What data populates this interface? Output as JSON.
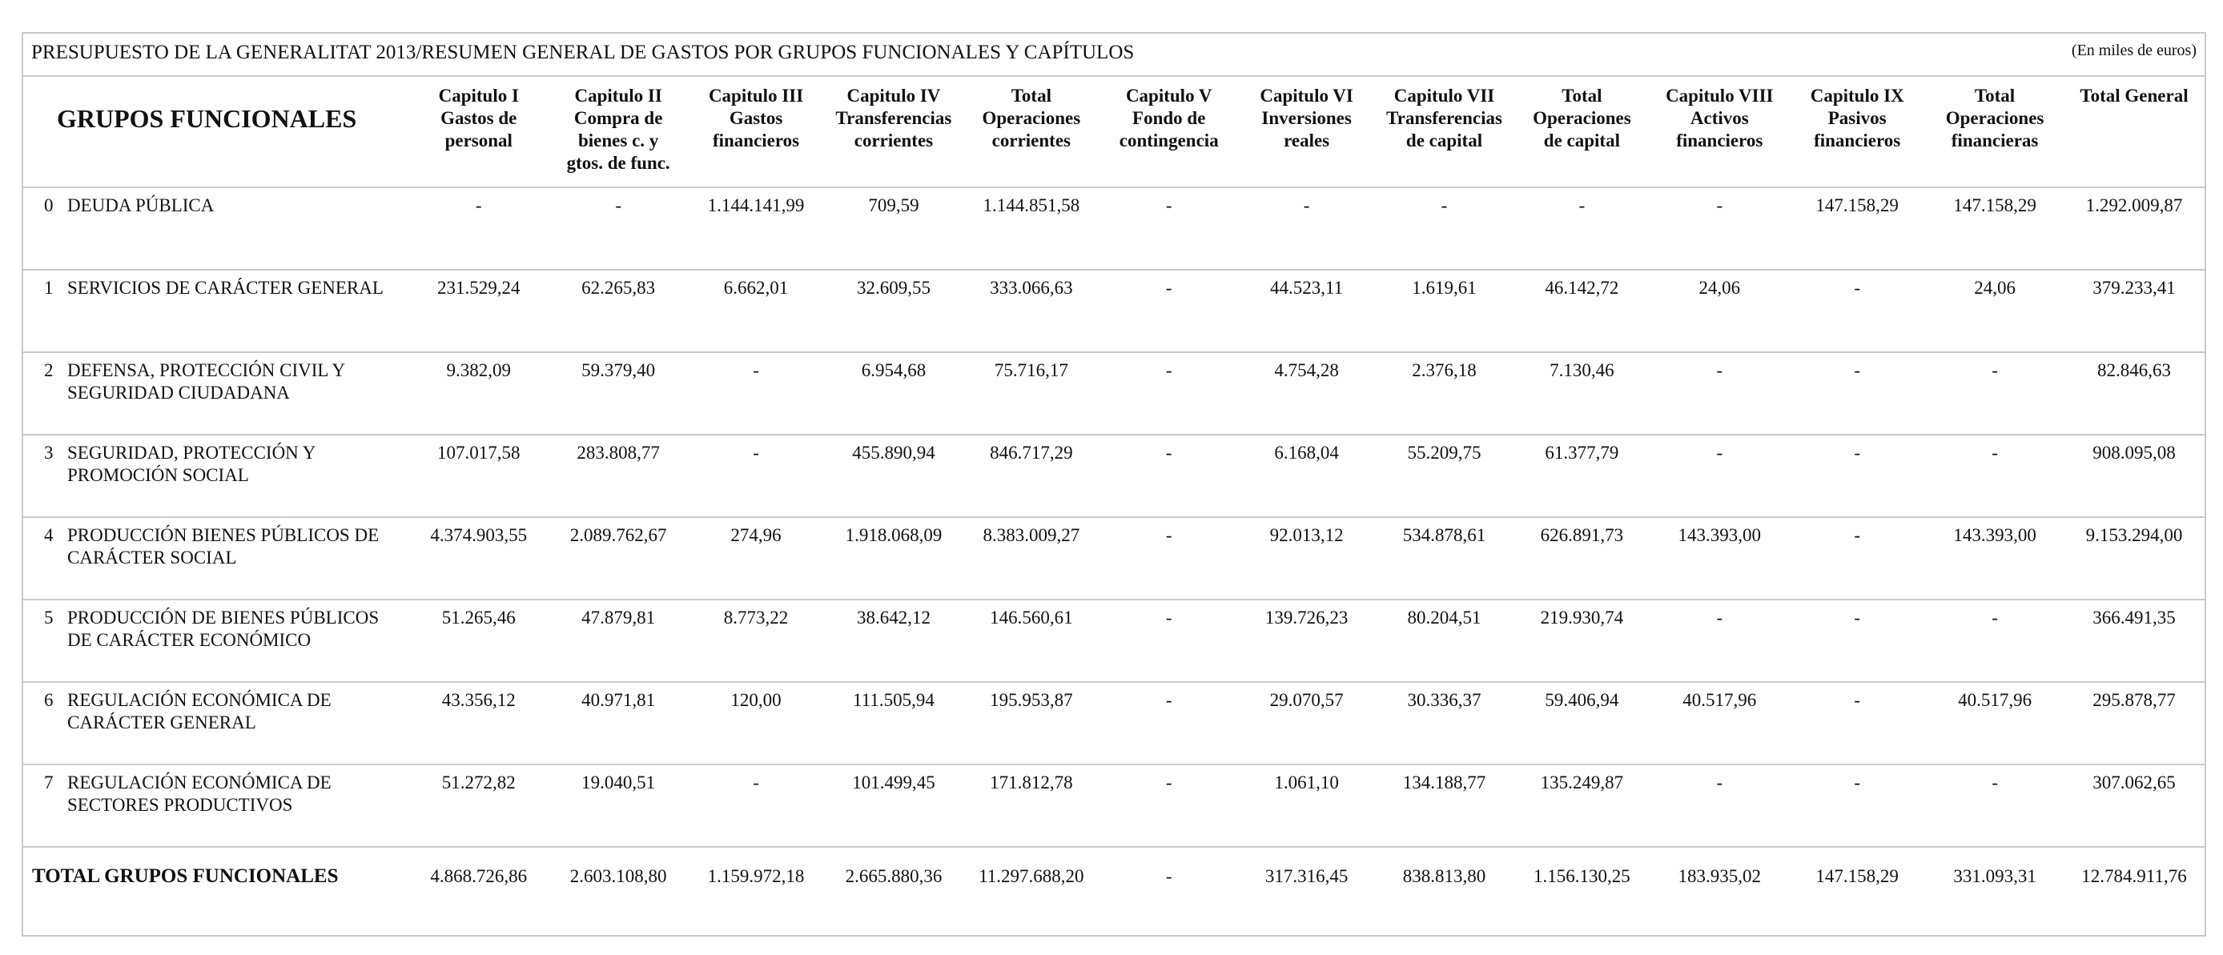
{
  "title": "PRESUPUESTO DE LA GENERALITAT 2013/RESUMEN GENERAL DE GASTOS POR GRUPOS FUNCIONALES Y CAPÍTULOS",
  "units": "(En miles de euros)",
  "table": {
    "group_header": "GRUPOS FUNCIONALES",
    "columns": [
      "Capitulo I\nGastos de\npersonal",
      "Capitulo II\nCompra de\nbienes c. y\ngtos. de func.",
      "Capitulo III\nGastos\nfinancieros",
      "Capitulo IV\nTransferencias\ncorrientes",
      "Total\nOperaciones\ncorrientes",
      "Capitulo V\nFondo de\ncontingencia",
      "Capitulo VI\nInversiones\nreales",
      "Capitulo VII\nTransferencias\nde capital",
      "Total\nOperaciones\nde capital",
      "Capitulo VIII\nActivos\nfinancieros",
      "Capitulo IX\nPasivos\nfinancieros",
      "Total\nOperaciones\nfinancieras",
      "Total General"
    ],
    "rows": [
      {
        "code": "0",
        "name": "DEUDA PÚBLICA",
        "values": [
          "-",
          "-",
          "1.144.141,99",
          "709,59",
          "1.144.851,58",
          "-",
          "-",
          "-",
          "-",
          "-",
          "147.158,29",
          "147.158,29",
          "1.292.009,87"
        ]
      },
      {
        "code": "1",
        "name": "SERVICIOS DE CARÁCTER GENERAL",
        "values": [
          "231.529,24",
          "62.265,83",
          "6.662,01",
          "32.609,55",
          "333.066,63",
          "-",
          "44.523,11",
          "1.619,61",
          "46.142,72",
          "24,06",
          "-",
          "24,06",
          "379.233,41"
        ]
      },
      {
        "code": "2",
        "name": "DEFENSA, PROTECCIÓN CIVIL Y SEGURIDAD CIUDADANA",
        "values": [
          "9.382,09",
          "59.379,40",
          "-",
          "6.954,68",
          "75.716,17",
          "-",
          "4.754,28",
          "2.376,18",
          "7.130,46",
          "-",
          "-",
          "-",
          "82.846,63"
        ]
      },
      {
        "code": "3",
        "name": "SEGURIDAD, PROTECCIÓN Y PROMOCIÓN SOCIAL",
        "values": [
          "107.017,58",
          "283.808,77",
          "-",
          "455.890,94",
          "846.717,29",
          "-",
          "6.168,04",
          "55.209,75",
          "61.377,79",
          "-",
          "-",
          "-",
          "908.095,08"
        ]
      },
      {
        "code": "4",
        "name": "PRODUCCIÓN BIENES PÚBLICOS DE CARÁCTER SOCIAL",
        "values": [
          "4.374.903,55",
          "2.089.762,67",
          "274,96",
          "1.918.068,09",
          "8.383.009,27",
          "-",
          "92.013,12",
          "534.878,61",
          "626.891,73",
          "143.393,00",
          "-",
          "143.393,00",
          "9.153.294,00"
        ]
      },
      {
        "code": "5",
        "name": "PRODUCCIÓN DE BIENES PÚBLICOS DE CARÁCTER ECONÓMICO",
        "values": [
          "51.265,46",
          "47.879,81",
          "8.773,22",
          "38.642,12",
          "146.560,61",
          "-",
          "139.726,23",
          "80.204,51",
          "219.930,74",
          "-",
          "-",
          "-",
          "366.491,35"
        ]
      },
      {
        "code": "6",
        "name": "REGULACIÓN ECONÓMICA DE CARÁCTER GENERAL",
        "values": [
          "43.356,12",
          "40.971,81",
          "120,00",
          "111.505,94",
          "195.953,87",
          "-",
          "29.070,57",
          "30.336,37",
          "59.406,94",
          "40.517,96",
          "-",
          "40.517,96",
          "295.878,77"
        ]
      },
      {
        "code": "7",
        "name": "REGULACIÓN ECONÓMICA DE SECTORES PRODUCTIVOS",
        "values": [
          "51.272,82",
          "19.040,51",
          "-",
          "101.499,45",
          "171.812,78",
          "-",
          "1.061,10",
          "134.188,77",
          "135.249,87",
          "-",
          "-",
          "-",
          "307.062,65"
        ]
      }
    ],
    "total": {
      "label": "TOTAL GRUPOS FUNCIONALES",
      "values": [
        "4.868.726,86",
        "2.603.108,80",
        "1.159.972,18",
        "2.665.880,36",
        "11.297.688,20",
        "-",
        "317.316,45",
        "838.813,80",
        "1.156.130,25",
        "183.935,02",
        "147.158,29",
        "331.093,31",
        "12.784.911,76"
      ]
    }
  }
}
